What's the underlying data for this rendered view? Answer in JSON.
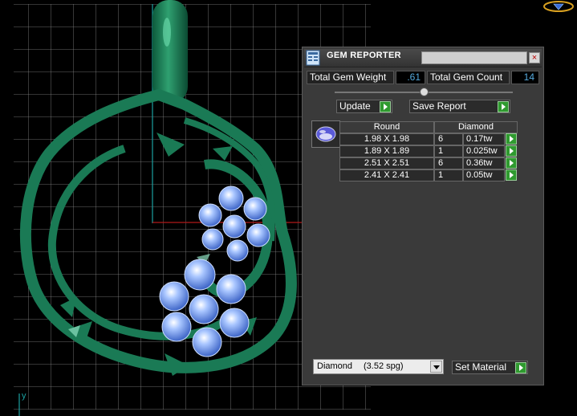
{
  "panel": {
    "title": "GEM REPORTER",
    "close_label": "×",
    "total_weight_label": "Total Gem Weight",
    "total_weight_value": ".61",
    "total_count_label": "Total Gem Count",
    "total_count_value": "14",
    "slider_fraction": 0.5,
    "update_label": "Update",
    "save_report_label": "Save Report"
  },
  "table": {
    "shape_header": "Round",
    "material_header": "Diamond",
    "rows": [
      {
        "size": "1.98 X 1.98",
        "qty": "6",
        "ctw": "0.17tw"
      },
      {
        "size": "1.89 X 1.89",
        "qty": "1",
        "ctw": "0.025tw"
      },
      {
        "size": "2.51 X 2.51",
        "qty": "6",
        "ctw": "0.36tw"
      },
      {
        "size": "2.41 X 2.41",
        "qty": "1",
        "ctw": "0.05tw"
      }
    ]
  },
  "material": {
    "selected": "Diamond",
    "density": "(3.52 spg)",
    "set_label": "Set Material"
  },
  "viewport": {
    "axis_label": "y",
    "accent_color": "#1a7a55",
    "gem_color": "#6f9ff2"
  }
}
